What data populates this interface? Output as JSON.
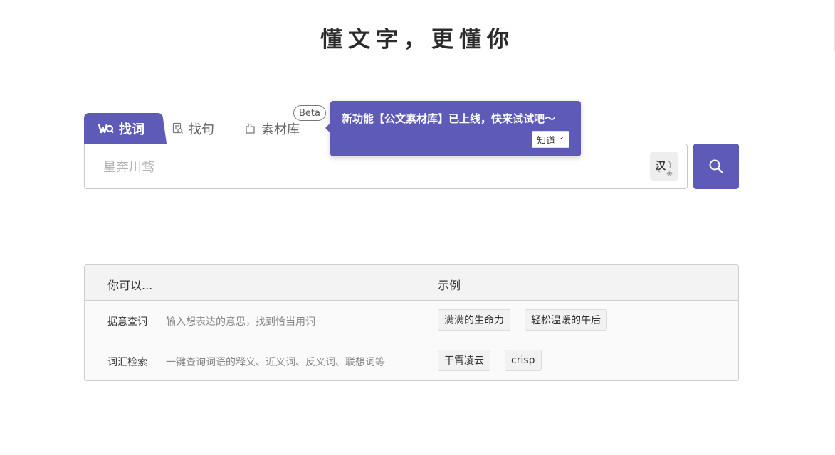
{
  "hero": {
    "title": "懂文字，更懂你"
  },
  "tabs": [
    {
      "label": "找词",
      "icon": "word-search-icon",
      "active": true
    },
    {
      "label": "找句",
      "icon": "sentence-search-icon",
      "active": false
    },
    {
      "label": "素材库",
      "icon": "material-library-icon",
      "active": false
    }
  ],
  "beta_badge": "Beta",
  "search": {
    "placeholder": "星奔川骛",
    "value": "",
    "toggle_main": "汉",
    "toggle_sub": "英"
  },
  "tooltip": {
    "text": "新功能【公文素材库】已上线，快来试试吧～",
    "button": "知道了"
  },
  "table": {
    "headers": [
      "你可以...",
      "示例"
    ],
    "rows": [
      {
        "name": "据意查词",
        "desc": "输入想表达的意思，找到恰当用词",
        "examples": [
          "满满的生命力",
          "轻松温暖的午后"
        ]
      },
      {
        "name": "词汇检索",
        "desc": "一键查询词语的释义、近义词、反义词、联想词等",
        "examples": [
          "干霄凌云",
          "crisp"
        ]
      }
    ]
  },
  "colors": {
    "accent": "#5e5bb8",
    "text": "#333333",
    "muted": "#888888"
  }
}
